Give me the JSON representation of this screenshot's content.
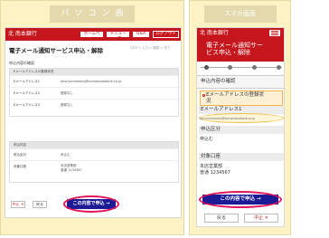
{
  "pc": {
    "tag": "パソコン画面",
    "logo": "北 南本銀行",
    "header_buttons": [
      "ホームページ",
      "メニュー一覧",
      "Q&A",
      "ログアウト"
    ],
    "title": "電子メール通知サービス申込・解除",
    "steps": "STEP 1 入力 > 確認 > 完了",
    "subtitle": "申込内容の確認",
    "section1_header": "Eメールアドレスの登録状況",
    "rows": [
      {
        "label": "Eメールアドレス1",
        "value": "taro.kumamoto@kumamotobank.co.jp"
      },
      {
        "label": "Eメールアドレス2",
        "value": "登録なし"
      },
      {
        "label": "Eメールアドレス3",
        "value": "登録なし"
      }
    ],
    "section2_header": "申込内容",
    "rows2": [
      {
        "label": "申込区分",
        "value": "申込む"
      },
      {
        "label": "対象口座",
        "value_line1": "本店営業部",
        "value_line2": "普通 1234567"
      }
    ],
    "cancel": "中止 ✕",
    "back": "戻る",
    "submit": "この内容で申込 →"
  },
  "sp": {
    "tag": "スマホ画面",
    "logo": "北 南本銀行",
    "title_line1": "電子メール通知サー",
    "title_line2": "ビス申込・解除",
    "section": "申込内容の確認",
    "sub_line1": "Eメールアドレスの登録状",
    "sub_line2": "況",
    "label_email": "Eメールアドレス1",
    "email_value": "taro.kumamoto@kumamotobank.co.jp",
    "label_kubun": "申込区分",
    "kubun_value": "申込む",
    "label_account": "対象口座",
    "account_line1": "本店営業部",
    "account_line2": "普通 1234567",
    "submit": "この内容で申込 →",
    "back": "戻る",
    "cancel": "中止 ✕"
  }
}
